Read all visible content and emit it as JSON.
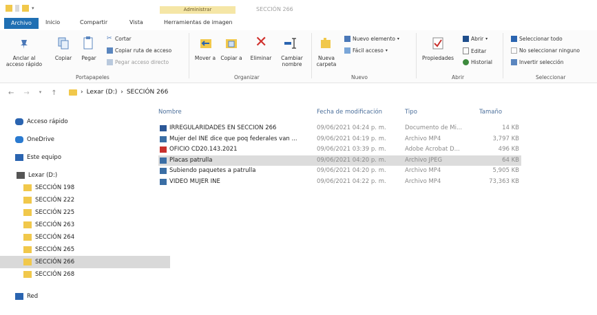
{
  "window": {
    "context_tab": "Administrar",
    "title": "SECCIÓN 266"
  },
  "tabs": [
    "Archivo",
    "Inicio",
    "Compartir",
    "Vista",
    "Herramientas de imagen"
  ],
  "ribbon": {
    "clipboard": {
      "pin_label": "Anclar al acceso rápido",
      "copy_label": "Copiar",
      "paste_label": "Pegar",
      "cut_label": "Cortar",
      "copy_path_label": "Copiar ruta de acceso",
      "paste_shortcut_label": "Pegar acceso directo",
      "group_label": "Portapapeles"
    },
    "organize": {
      "move_label": "Mover a",
      "copy_to_label": "Copiar a",
      "delete_label": "Eliminar",
      "rename_label": "Cambiar nombre",
      "group_label": "Organizar"
    },
    "new": {
      "new_folder_label": "Nueva carpeta",
      "new_item_label": "Nuevo elemento",
      "easy_access_label": "Fácil acceso",
      "group_label": "Nuevo"
    },
    "open": {
      "properties_label": "Propiedades",
      "open_label": "Abrir",
      "edit_label": "Editar",
      "history_label": "Historial",
      "group_label": "Abrir"
    },
    "select": {
      "select_all_label": "Seleccionar todo",
      "select_none_label": "No seleccionar ninguno",
      "invert_label": "Invertir selección",
      "group_label": "Seleccionar"
    }
  },
  "address": {
    "drive": "Lexar (D:)",
    "folder": "SECCIÓN 266"
  },
  "sidebar": [
    {
      "label": "Acceso rápido",
      "icon": "star-icon"
    },
    {
      "label": "OneDrive",
      "icon": "cloud-icon"
    },
    {
      "label": "Este equipo",
      "icon": "computer-icon"
    },
    {
      "label": "Lexar (D:)",
      "icon": "drive-icon"
    },
    {
      "label": "SECCIÓN 198",
      "icon": "folder-icon"
    },
    {
      "label": "SECCIÓN 222",
      "icon": "folder-icon"
    },
    {
      "label": "SECCIÓN 225",
      "icon": "folder-icon"
    },
    {
      "label": "SECCIÓN 263",
      "icon": "folder-icon"
    },
    {
      "label": "SECCIÓN 264",
      "icon": "folder-icon"
    },
    {
      "label": "SECCIÓN 265",
      "icon": "folder-icon"
    },
    {
      "label": "SECCIÓN 266",
      "icon": "folder-icon"
    },
    {
      "label": "SECCIÓN 268",
      "icon": "folder-icon"
    },
    {
      "label": "Red",
      "icon": "network-icon"
    }
  ],
  "columns": {
    "name": "Nombre",
    "date": "Fecha de modificación",
    "type": "Tipo",
    "size": "Tamaño"
  },
  "files": [
    {
      "name": "IRREGULARIDADES EN SECCIÓN 266",
      "date": "09/06/2021 04:24 p. m.",
      "type": "Documento de Mi...",
      "size": "14 KB",
      "icon": "word-doc-icon",
      "color": "#2b5797"
    },
    {
      "name": "Mujer del INE dice que poq federales van ...",
      "date": "09/06/2021 04:19 p. m.",
      "type": "Archivo MP4",
      "size": "3,797 KB",
      "icon": "video-file-icon",
      "color": "#3a6ea5"
    },
    {
      "name": "OFICIO CD20.143.2021",
      "date": "09/06/2021 03:39 p. m.",
      "type": "Adobe Acrobat D...",
      "size": "496 KB",
      "icon": "pdf-file-icon",
      "color": "#c8302c"
    },
    {
      "name": "Placas patrulla",
      "date": "09/06/2021 04:20 p. m.",
      "type": "Archivo JPEG",
      "size": "64 KB",
      "icon": "image-file-icon",
      "color": "#3a6ea5"
    },
    {
      "name": "Subiendo paquetes a patrulla",
      "date": "09/06/2021 04:20 p. m.",
      "type": "Archivo MP4",
      "size": "5,905 KB",
      "icon": "video-file-icon",
      "color": "#3a6ea5"
    },
    {
      "name": "VIDEO MUJER INE",
      "date": "09/06/2021 04:22 p. m.",
      "type": "Archivo MP4",
      "size": "73,363 KB",
      "icon": "video-file-icon",
      "color": "#3a6ea5"
    }
  ]
}
